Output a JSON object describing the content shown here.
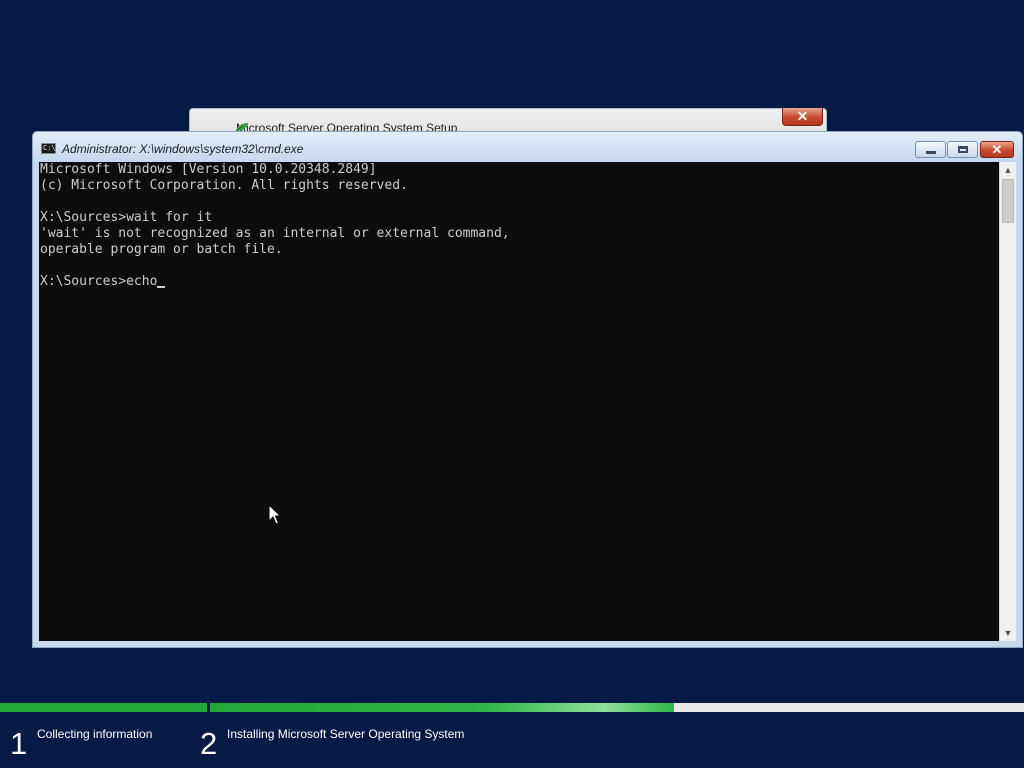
{
  "setup_window": {
    "title": "Microsoft Server Operating System Setup",
    "close_label": "✕"
  },
  "cmd_window": {
    "title": "Administrator: X:\\windows\\system32\\cmd.exe",
    "icon_text": "C:\\",
    "close_label": "✕"
  },
  "console": {
    "lines": [
      "Microsoft Windows [Version 10.0.20348.2849]",
      "(c) Microsoft Corporation. All rights reserved.",
      "",
      "X:\\Sources>wait for it",
      "'wait' is not recognized as an internal or external command,",
      "operable program or batch file.",
      ""
    ],
    "current_prompt": "X:\\Sources>echo"
  },
  "scrollbar": {
    "up_arrow": "▲",
    "down_arrow": "▼"
  },
  "setup_steps": [
    {
      "number": "1",
      "label": "Collecting information",
      "progress": 1.0
    },
    {
      "number": "2",
      "label": "Installing Microsoft Server Operating System",
      "progress": 0.57
    }
  ],
  "colors": {
    "desktop_background": "#051a45",
    "console_background": "#0c0c0c",
    "console_text": "#cccccc",
    "progress_green": "#2fb64a"
  }
}
